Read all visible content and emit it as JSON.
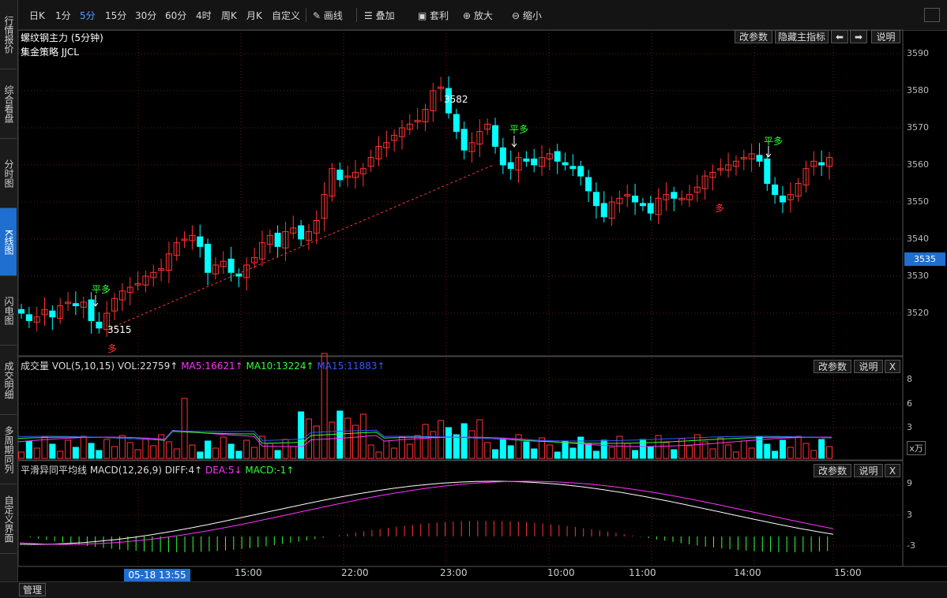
{
  "sidebar": {
    "tabs": [
      {
        "label": "行情报价",
        "active": false
      },
      {
        "label": "综合看盘",
        "active": false
      },
      {
        "label": "分时图",
        "active": false
      },
      {
        "label": "K线图",
        "active": true
      },
      {
        "label": "闪电图",
        "active": false
      },
      {
        "label": "成交明细",
        "active": false
      },
      {
        "label": "多周期同列",
        "active": false
      },
      {
        "label": "自定义界面",
        "active": false
      }
    ]
  },
  "toolbar": {
    "periods": [
      "日K",
      "1分",
      "5分",
      "15分",
      "30分",
      "60分",
      "4时",
      "周K",
      "月K",
      "自定义"
    ],
    "active_period": "5分",
    "draw_label": "画线",
    "overlay_label": "叠加",
    "arbitrage_label": "套利",
    "zoom_in_label": "放大",
    "zoom_out_label": "缩小"
  },
  "main_panel": {
    "title": "螺纹钢主力 (5分钟)",
    "strategy": "集金策略 JJCL",
    "btn_params": "改参数",
    "btn_hide": "隐藏主指标",
    "btn_help": "说明",
    "annotations": {
      "high": "3582",
      "low": "3515",
      "flat_long": "平多",
      "long": "多"
    },
    "price_axis": [
      "3590",
      "3580",
      "3570",
      "3560",
      "3550",
      "3540",
      "3530",
      "3520"
    ],
    "current_price": "3535"
  },
  "volume_panel": {
    "title": "成交量 VOL(5,10,15)",
    "vol": "VOL:22759↑",
    "ma5": "MA5:16621↑",
    "ma10": "MA10:13224↑",
    "ma15": "MA15:11883↑",
    "btn_params": "改参数",
    "btn_help": "说明",
    "btn_close": "X",
    "axis": [
      "8",
      "6",
      "3"
    ],
    "unit": "x万"
  },
  "macd_panel": {
    "title": "平滑异同平均线 MACD(12,26,9)",
    "diff": "DIFF:4↑",
    "dea": "DEA:5↓",
    "macd": "MACD:-1↑",
    "btn_params": "改参数",
    "btn_help": "说明",
    "btn_close": "X",
    "axis": [
      "9",
      "3",
      "-3"
    ]
  },
  "time_axis": {
    "cursor": "05-18 13:55",
    "labels": [
      "15:00",
      "22:00",
      "23:00",
      "10:00",
      "11:00",
      "14:00",
      "15:00"
    ]
  },
  "bottom": {
    "manage": "管理"
  },
  "colors": {
    "up": "#ff3333",
    "down": "#00ffff",
    "accent": "#1e6fd0",
    "ma5": "#ff33ff",
    "ma10": "#33ff33",
    "ma15": "#3355ff",
    "grid": "#6a1a1a"
  }
}
